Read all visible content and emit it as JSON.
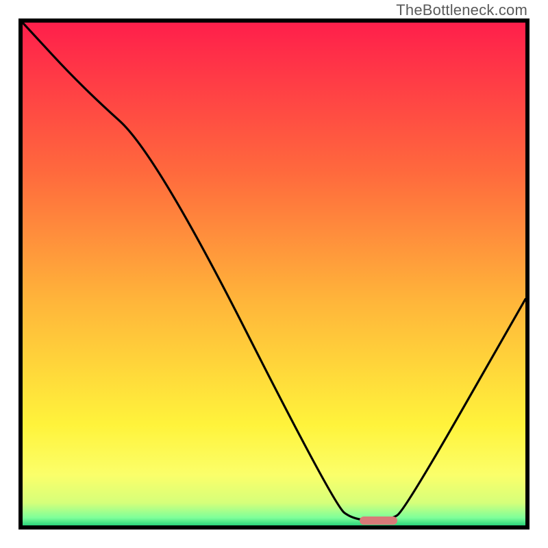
{
  "watermark": "TheBottleneck.com",
  "chart_data": {
    "type": "line",
    "title": "",
    "xlabel": "",
    "ylabel": "",
    "xlim": [
      0,
      100
    ],
    "ylim": [
      0,
      100
    ],
    "grid": false,
    "legend": null,
    "background_gradient": {
      "stops": [
        {
          "offset": 0,
          "color": "#ff1f4b"
        },
        {
          "offset": 0.3,
          "color": "#ff6a3d"
        },
        {
          "offset": 0.55,
          "color": "#ffb43a"
        },
        {
          "offset": 0.8,
          "color": "#fff33b"
        },
        {
          "offset": 0.9,
          "color": "#fbff6a"
        },
        {
          "offset": 0.955,
          "color": "#d6ff7a"
        },
        {
          "offset": 0.985,
          "color": "#7dff9a"
        },
        {
          "offset": 1.0,
          "color": "#2bd47b"
        }
      ]
    },
    "series": [
      {
        "name": "bottleneck-curve",
        "x": [
          0,
          12,
          26.5,
          62,
          66,
          73,
          76,
          100
        ],
        "y": [
          100,
          87,
          74,
          4,
          1,
          1,
          3,
          45
        ]
      }
    ],
    "marker": {
      "name": "optimal-point",
      "x_range": [
        67,
        74.5
      ],
      "y": 1,
      "color": "#d87a78"
    },
    "annotations": []
  }
}
